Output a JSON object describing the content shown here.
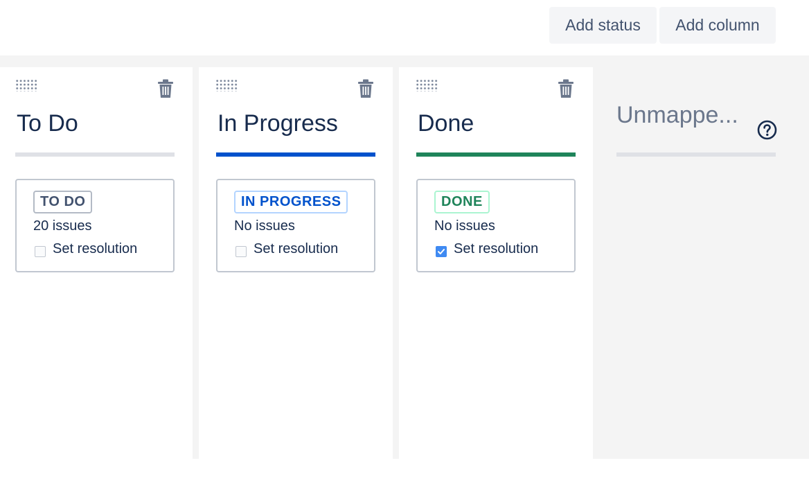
{
  "toolbar": {
    "add_status_label": "Add status",
    "add_column_label": "Add column"
  },
  "columns": [
    {
      "title": "To Do",
      "bar_color": "#dfe1e6",
      "status": {
        "lozenge_label": "TO DO",
        "lozenge_color": "#42526e",
        "lozenge_border": "#b3bac5",
        "issues": "20 issues",
        "resolution_label": "Set resolution",
        "resolution_checked": false
      }
    },
    {
      "title": "In Progress",
      "bar_color": "#0052cc",
      "status": {
        "lozenge_label": "IN PROGRESS",
        "lozenge_color": "#0052cc",
        "lozenge_border": "#b3d4ff",
        "issues": "No issues",
        "resolution_label": "Set resolution",
        "resolution_checked": false
      }
    },
    {
      "title": "Done",
      "bar_color": "#1f845a",
      "status": {
        "lozenge_label": "DONE",
        "lozenge_color": "#1f845a",
        "lozenge_border": "#abf5d1",
        "issues": "No issues",
        "resolution_label": "Set resolution",
        "resolution_checked": true
      }
    }
  ],
  "unmapped": {
    "title": "Unmappe...",
    "bar_color": "#dfe1e6"
  },
  "icons": {
    "drag": "drag-handle-icon",
    "delete": "trash-icon",
    "help": "question-circle-icon",
    "check": "checkmark-icon"
  },
  "colors": {
    "board_bg": "#f4f4f4",
    "button_bg": "#f4f5f7",
    "checkbox_checked": "#3f8af2"
  }
}
